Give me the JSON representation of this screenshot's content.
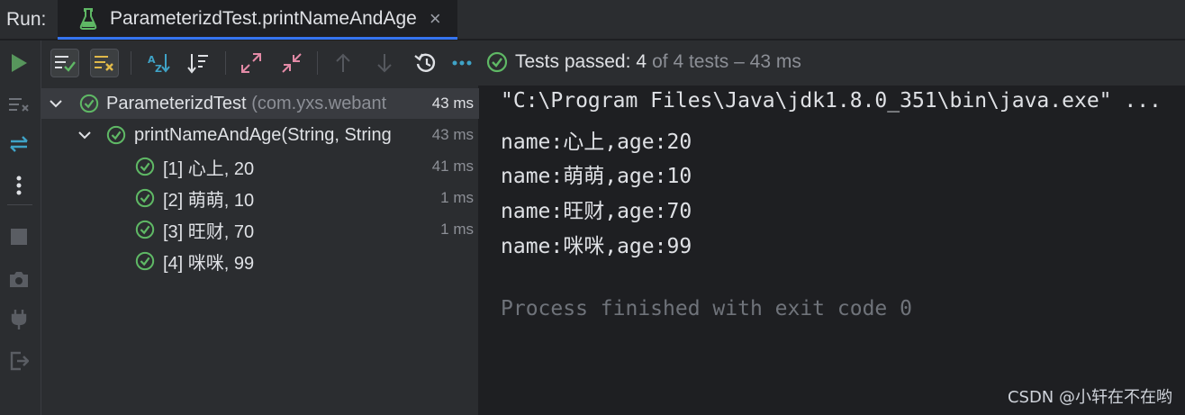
{
  "window": {
    "run_label": "Run:",
    "tab_title": "ParameterizdTest.printNameAndAge",
    "tab_close": "×"
  },
  "toolbar": {
    "status_prefix": "Tests passed:",
    "status_count": "4",
    "status_rest": "of 4 tests – 43 ms"
  },
  "tree": {
    "root": {
      "name": "ParameterizdTest",
      "package": "(com.yxs.webant",
      "time": "43 ms"
    },
    "method": {
      "name": "printNameAndAge(String, String",
      "time": "43 ms"
    },
    "cases": [
      {
        "label": "[1] 心上, 20",
        "time": "41 ms"
      },
      {
        "label": "[2] 萌萌, 10",
        "time": "1 ms"
      },
      {
        "label": "[3] 旺财, 70",
        "time": "1 ms"
      },
      {
        "label": "[4] 咪咪, 99",
        "time": ""
      }
    ]
  },
  "console": {
    "lines": [
      "\"C:\\Program Files\\Java\\jdk1.8.0_351\\bin\\java.exe\"  ...",
      "name:心上,age:20",
      "name:萌萌,age:10",
      "name:旺财,age:70",
      "name:咪咪,age:99"
    ],
    "exit_line": "Process finished with exit code 0"
  },
  "watermark": "CSDN @小轩在不在哟",
  "colors": {
    "accent": "#3574f0",
    "pass_green": "#5fb865",
    "run_green": "#57965c",
    "warn_yellow": "#e0b94a",
    "cyan": "#3fa3c7"
  },
  "icons": [
    "flask-icon",
    "play-icon",
    "show-passed-icon",
    "show-ignored-icon",
    "sort-alpha-icon",
    "sort-duration-icon",
    "expand-all-icon",
    "collapse-all-icon",
    "prev-failed-icon",
    "next-failed-icon",
    "history-icon",
    "more-icon",
    "check-circle-icon"
  ]
}
